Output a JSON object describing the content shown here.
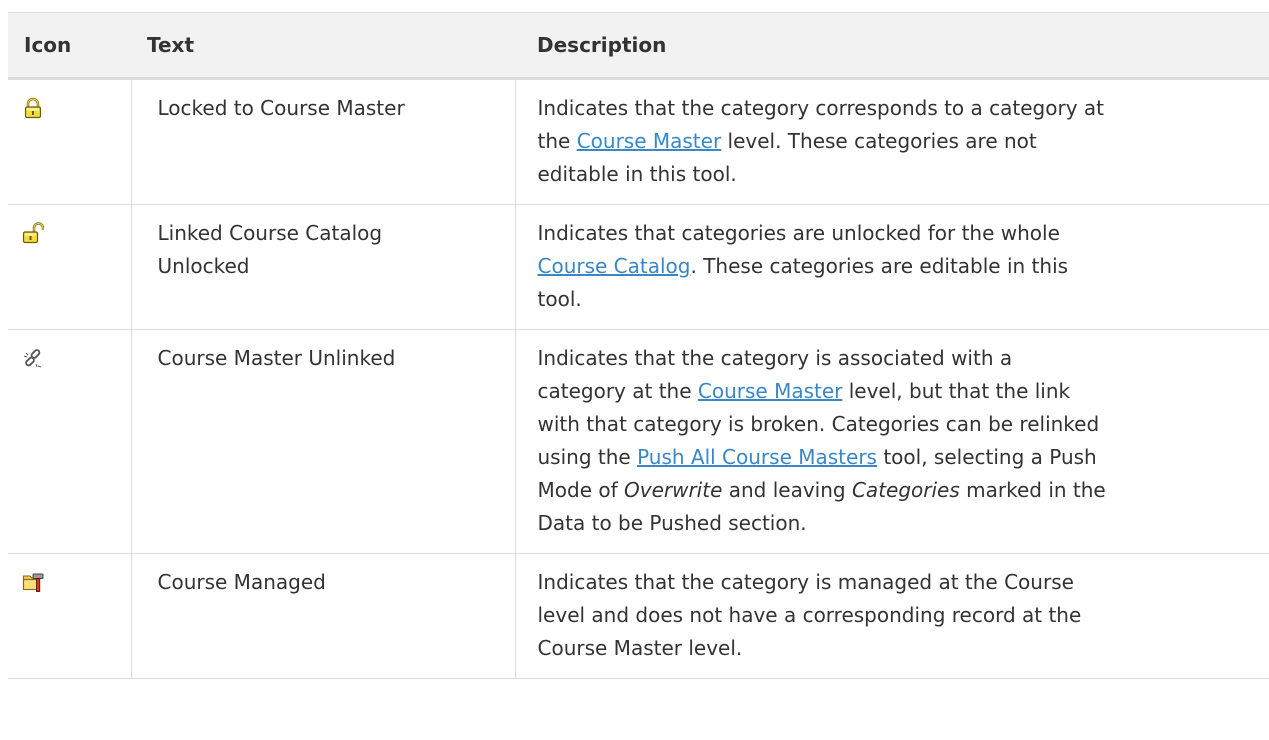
{
  "table": {
    "headers": {
      "icon": "Icon",
      "text": "Text",
      "description": "Description"
    },
    "rows": [
      {
        "icon": "locked-padlock-icon",
        "text": "Locked to Course Master",
        "desc": {
          "l1": "Indicates that the category corresponds to a category at",
          "l2_pre": "the ",
          "l2_link": "Course Master",
          "l2_post": " level. These categories are not",
          "l3": "editable in this tool."
        }
      },
      {
        "icon": "unlocked-padlock-icon",
        "text_l1": "Linked Course Catalog",
        "text_l2": "Unlocked",
        "desc": {
          "l1": "Indicates that categories are unlocked for the whole",
          "l2_link": "Course Catalog",
          "l2_post": ". These categories are editable in this",
          "l3": "tool."
        }
      },
      {
        "icon": "broken-link-icon",
        "text": "Course Master Unlinked",
        "desc": {
          "l1": "Indicates that the category is associated with a",
          "l2_pre": "category at the ",
          "l2_link": "Course Master",
          "l2_post": " level, but that the link",
          "l3": "with that category is broken. Categories can be relinked",
          "l4_pre": "using the ",
          "l4_link": "Push All Course Masters",
          "l4_post": " tool, selecting a Push",
          "l5_pre": "Mode of ",
          "l5_em1": "Overwrite",
          "l5_mid": " and leaving ",
          "l5_em2": "Categories",
          "l5_post": " marked in the",
          "l6": "Data to be Pushed section."
        }
      },
      {
        "icon": "folder-hammer-icon",
        "text": "Course Managed",
        "desc": {
          "l1": "Indicates that the category is managed at the Course",
          "l2": "level and does not have a corresponding record at the",
          "l3": "Course Master level."
        }
      }
    ]
  },
  "colors": {
    "header_bg": "#f2f2f2",
    "border": "#dddddd",
    "text": "#333333",
    "link": "#3a87c8"
  }
}
